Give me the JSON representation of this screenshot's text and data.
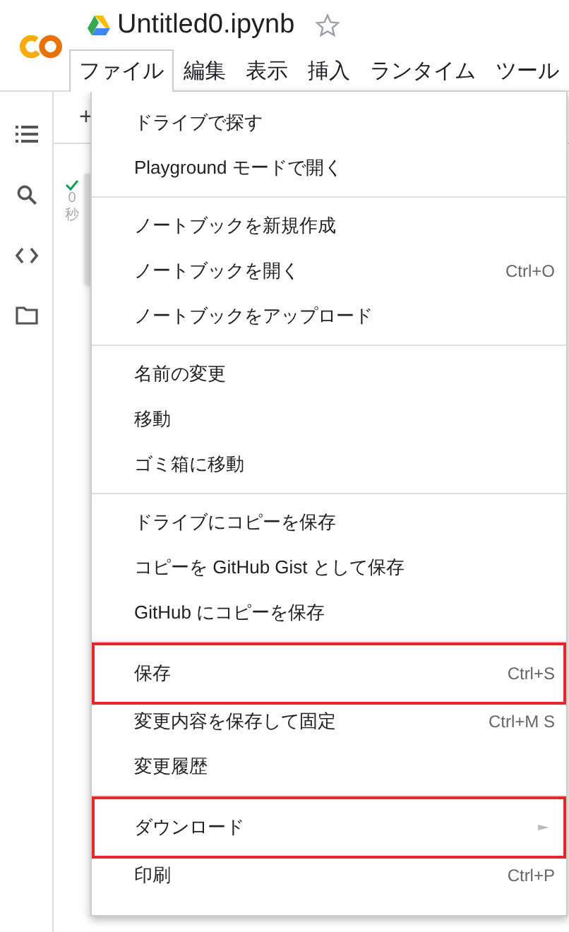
{
  "app": {
    "title": "Untitled0.ipynb",
    "starred": false
  },
  "menubar": [
    {
      "label": "ファイル",
      "selected": true
    },
    {
      "label": "編集",
      "selected": false
    },
    {
      "label": "表示",
      "selected": false
    },
    {
      "label": "挿入",
      "selected": false
    },
    {
      "label": "ランタイム",
      "selected": false
    },
    {
      "label": "ツール",
      "selected": false
    }
  ],
  "toolbar": {
    "add": "+"
  },
  "cell": {
    "duration": "0",
    "unit": "秒"
  },
  "file_menu": {
    "groups": [
      {
        "items": [
          {
            "label": "ドライブで探す",
            "highlighted": false
          },
          {
            "label": "Playground モードで開く",
            "highlighted": false
          }
        ]
      },
      {
        "items": [
          {
            "label": "ノートブックを新規作成",
            "highlighted": false
          },
          {
            "label": "ノートブックを開く",
            "shortcut": "Ctrl+O",
            "highlighted": false
          },
          {
            "label": "ノートブックをアップロード",
            "highlighted": false
          }
        ]
      },
      {
        "items": [
          {
            "label": "名前の変更",
            "highlighted": false
          },
          {
            "label": "移動",
            "highlighted": false
          },
          {
            "label": "ゴミ箱に移動",
            "highlighted": false
          }
        ]
      },
      {
        "items": [
          {
            "label": "ドライブにコピーを保存",
            "highlighted": false
          },
          {
            "label": "コピーを GitHub Gist として保存",
            "highlighted": false
          },
          {
            "label": "GitHub にコピーを保存",
            "highlighted": false
          }
        ]
      },
      {
        "items": [
          {
            "label": "保存",
            "shortcut": "Ctrl+S",
            "highlighted": true
          },
          {
            "label": "変更内容を保存して固定",
            "shortcut": "Ctrl+M S",
            "highlighted": false
          },
          {
            "label": "変更履歴",
            "highlighted": false
          }
        ]
      },
      {
        "items": [
          {
            "label": "ダウンロード",
            "kind": "submenu",
            "highlighted": true
          },
          {
            "label": "印刷",
            "shortcut": "Ctrl+P",
            "highlighted": false
          }
        ]
      }
    ]
  }
}
